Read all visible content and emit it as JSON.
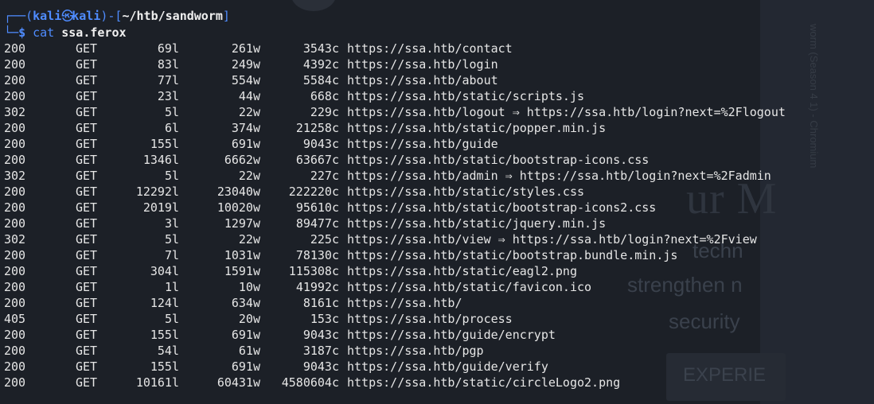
{
  "prompt": {
    "corner_top": "┌──(",
    "user": "kali",
    "skull": "㉿",
    "host": "kali",
    "sep": ")-[",
    "path": "~/htb/sandworm",
    "close": "]",
    "corner_bottom": "└─",
    "dollar": "$",
    "command": "cat",
    "argument": "ssa.ferox"
  },
  "results": [
    {
      "status": "200",
      "method": "GET",
      "lines": "69l",
      "words": "261w",
      "chars": "3543c",
      "url": "https://ssa.htb/contact"
    },
    {
      "status": "200",
      "method": "GET",
      "lines": "83l",
      "words": "249w",
      "chars": "4392c",
      "url": "https://ssa.htb/login"
    },
    {
      "status": "200",
      "method": "GET",
      "lines": "77l",
      "words": "554w",
      "chars": "5584c",
      "url": "https://ssa.htb/about"
    },
    {
      "status": "200",
      "method": "GET",
      "lines": "23l",
      "words": "44w",
      "chars": "668c",
      "url": "https://ssa.htb/static/scripts.js"
    },
    {
      "status": "302",
      "method": "GET",
      "lines": "5l",
      "words": "22w",
      "chars": "229c",
      "url": "https://ssa.htb/logout ⇒ https://ssa.htb/login?next=%2Flogout"
    },
    {
      "status": "200",
      "method": "GET",
      "lines": "6l",
      "words": "374w",
      "chars": "21258c",
      "url": "https://ssa.htb/static/popper.min.js"
    },
    {
      "status": "200",
      "method": "GET",
      "lines": "155l",
      "words": "691w",
      "chars": "9043c",
      "url": "https://ssa.htb/guide"
    },
    {
      "status": "200",
      "method": "GET",
      "lines": "1346l",
      "words": "6662w",
      "chars": "63667c",
      "url": "https://ssa.htb/static/bootstrap-icons.css"
    },
    {
      "status": "302",
      "method": "GET",
      "lines": "5l",
      "words": "22w",
      "chars": "227c",
      "url": "https://ssa.htb/admin ⇒ https://ssa.htb/login?next=%2Fadmin"
    },
    {
      "status": "200",
      "method": "GET",
      "lines": "12292l",
      "words": "23040w",
      "chars": "222220c",
      "url": "https://ssa.htb/static/styles.css"
    },
    {
      "status": "200",
      "method": "GET",
      "lines": "2019l",
      "words": "10020w",
      "chars": "95610c",
      "url": "https://ssa.htb/static/bootstrap-icons2.css"
    },
    {
      "status": "200",
      "method": "GET",
      "lines": "3l",
      "words": "1297w",
      "chars": "89477c",
      "url": "https://ssa.htb/static/jquery.min.js"
    },
    {
      "status": "302",
      "method": "GET",
      "lines": "5l",
      "words": "22w",
      "chars": "225c",
      "url": "https://ssa.htb/view ⇒ https://ssa.htb/login?next=%2Fview"
    },
    {
      "status": "200",
      "method": "GET",
      "lines": "7l",
      "words": "1031w",
      "chars": "78130c",
      "url": "https://ssa.htb/static/bootstrap.bundle.min.js"
    },
    {
      "status": "200",
      "method": "GET",
      "lines": "304l",
      "words": "1591w",
      "chars": "115308c",
      "url": "https://ssa.htb/static/eagl2.png"
    },
    {
      "status": "200",
      "method": "GET",
      "lines": "1l",
      "words": "10w",
      "chars": "41992c",
      "url": "https://ssa.htb/static/favicon.ico"
    },
    {
      "status": "200",
      "method": "GET",
      "lines": "124l",
      "words": "634w",
      "chars": "8161c",
      "url": "https://ssa.htb/"
    },
    {
      "status": "405",
      "method": "GET",
      "lines": "5l",
      "words": "20w",
      "chars": "153c",
      "url": "https://ssa.htb/process"
    },
    {
      "status": "200",
      "method": "GET",
      "lines": "155l",
      "words": "691w",
      "chars": "9043c",
      "url": "https://ssa.htb/guide/encrypt"
    },
    {
      "status": "200",
      "method": "GET",
      "lines": "54l",
      "words": "61w",
      "chars": "3187c",
      "url": "https://ssa.htb/pgp"
    },
    {
      "status": "200",
      "method": "GET",
      "lines": "155l",
      "words": "691w",
      "chars": "9043c",
      "url": "https://ssa.htb/guide/verify"
    },
    {
      "status": "200",
      "method": "GET",
      "lines": "10161l",
      "words": "60431w",
      "chars": "4580604c",
      "url": "https://ssa.htb/static/circleLogo2.png"
    }
  ],
  "background_page": {
    "heading": "ur M",
    "line1": "techn",
    "line2": "strengthen n",
    "line3": "security",
    "button": "EXPERIE",
    "vertical": "worm (Season 4 1) - Chromium"
  },
  "colors": {
    "background": "#1c2027",
    "prompt_blue": "#4f8cff",
    "text": "#e6e6e6"
  }
}
